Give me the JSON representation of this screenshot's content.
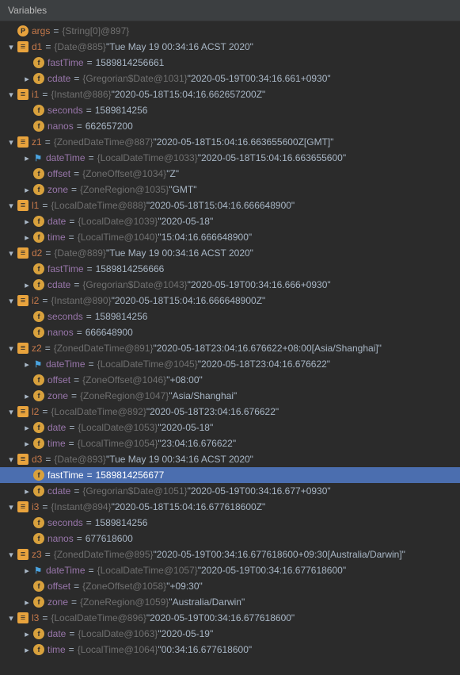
{
  "header": {
    "title": "Variables"
  },
  "rows": [
    {
      "indent": 0,
      "arrow": "none",
      "icon": "p",
      "iconText": "P",
      "name": "args",
      "nameClass": "",
      "type": "{String[0]@897}",
      "value": "",
      "selected": false
    },
    {
      "indent": 0,
      "arrow": "down",
      "icon": "obj",
      "iconText": "",
      "name": "d1",
      "nameClass": "",
      "type": "{Date@885}",
      "value": "\"Tue May 19 00:34:16 ACST 2020\"",
      "selected": false
    },
    {
      "indent": 1,
      "arrow": "none",
      "icon": "f",
      "iconText": "f",
      "name": "fastTime",
      "nameClass": "purple",
      "type": "",
      "value": "1589814256661",
      "selected": false
    },
    {
      "indent": 1,
      "arrow": "right",
      "icon": "f",
      "iconText": "f",
      "name": "cdate",
      "nameClass": "purple",
      "type": "{Gregorian$Date@1031}",
      "value": "\"2020-05-19T00:34:16.661+0930\"",
      "selected": false
    },
    {
      "indent": 0,
      "arrow": "down",
      "icon": "obj",
      "iconText": "",
      "name": "i1",
      "nameClass": "",
      "type": "{Instant@886}",
      "value": "\"2020-05-18T15:04:16.662657200Z\"",
      "selected": false
    },
    {
      "indent": 1,
      "arrow": "none",
      "icon": "f",
      "iconText": "f",
      "name": "seconds",
      "nameClass": "purple",
      "type": "",
      "value": "1589814256",
      "selected": false
    },
    {
      "indent": 1,
      "arrow": "none",
      "icon": "f",
      "iconText": "f",
      "name": "nanos",
      "nameClass": "purple",
      "type": "",
      "value": "662657200",
      "selected": false
    },
    {
      "indent": 0,
      "arrow": "down",
      "icon": "obj",
      "iconText": "",
      "name": "z1",
      "nameClass": "",
      "type": "{ZonedDateTime@887}",
      "value": "\"2020-05-18T15:04:16.663655600Z[GMT]\"",
      "selected": false
    },
    {
      "indent": 1,
      "arrow": "right",
      "icon": "flag",
      "iconText": "",
      "name": "dateTime",
      "nameClass": "purple",
      "type": "{LocalDateTime@1033}",
      "value": "\"2020-05-18T15:04:16.663655600\"",
      "selected": false
    },
    {
      "indent": 1,
      "arrow": "none",
      "icon": "f",
      "iconText": "f",
      "name": "offset",
      "nameClass": "purple",
      "type": "{ZoneOffset@1034}",
      "value": "\"Z\"",
      "selected": false
    },
    {
      "indent": 1,
      "arrow": "right",
      "icon": "f",
      "iconText": "f",
      "name": "zone",
      "nameClass": "purple",
      "type": "{ZoneRegion@1035}",
      "value": "\"GMT\"",
      "selected": false
    },
    {
      "indent": 0,
      "arrow": "down",
      "icon": "obj",
      "iconText": "",
      "name": "l1",
      "nameClass": "",
      "type": "{LocalDateTime@888}",
      "value": "\"2020-05-18T15:04:16.666648900\"",
      "selected": false
    },
    {
      "indent": 1,
      "arrow": "right",
      "icon": "f",
      "iconText": "f",
      "name": "date",
      "nameClass": "purple",
      "type": "{LocalDate@1039}",
      "value": "\"2020-05-18\"",
      "selected": false
    },
    {
      "indent": 1,
      "arrow": "right",
      "icon": "f",
      "iconText": "f",
      "name": "time",
      "nameClass": "purple",
      "type": "{LocalTime@1040}",
      "value": "\"15:04:16.666648900\"",
      "selected": false
    },
    {
      "indent": 0,
      "arrow": "down",
      "icon": "obj",
      "iconText": "",
      "name": "d2",
      "nameClass": "",
      "type": "{Date@889}",
      "value": "\"Tue May 19 00:34:16 ACST 2020\"",
      "selected": false
    },
    {
      "indent": 1,
      "arrow": "none",
      "icon": "f",
      "iconText": "f",
      "name": "fastTime",
      "nameClass": "purple",
      "type": "",
      "value": "1589814256666",
      "selected": false
    },
    {
      "indent": 1,
      "arrow": "right",
      "icon": "f",
      "iconText": "f",
      "name": "cdate",
      "nameClass": "purple",
      "type": "{Gregorian$Date@1043}",
      "value": "\"2020-05-19T00:34:16.666+0930\"",
      "selected": false
    },
    {
      "indent": 0,
      "arrow": "down",
      "icon": "obj",
      "iconText": "",
      "name": "i2",
      "nameClass": "",
      "type": "{Instant@890}",
      "value": "\"2020-05-18T15:04:16.666648900Z\"",
      "selected": false
    },
    {
      "indent": 1,
      "arrow": "none",
      "icon": "f",
      "iconText": "f",
      "name": "seconds",
      "nameClass": "purple",
      "type": "",
      "value": "1589814256",
      "selected": false
    },
    {
      "indent": 1,
      "arrow": "none",
      "icon": "f",
      "iconText": "f",
      "name": "nanos",
      "nameClass": "purple",
      "type": "",
      "value": "666648900",
      "selected": false
    },
    {
      "indent": 0,
      "arrow": "down",
      "icon": "obj",
      "iconText": "",
      "name": "z2",
      "nameClass": "",
      "type": "{ZonedDateTime@891}",
      "value": "\"2020-05-18T23:04:16.676622+08:00[Asia/Shanghai]\"",
      "selected": false
    },
    {
      "indent": 1,
      "arrow": "right",
      "icon": "flag",
      "iconText": "",
      "name": "dateTime",
      "nameClass": "purple",
      "type": "{LocalDateTime@1045}",
      "value": "\"2020-05-18T23:04:16.676622\"",
      "selected": false
    },
    {
      "indent": 1,
      "arrow": "none",
      "icon": "f",
      "iconText": "f",
      "name": "offset",
      "nameClass": "purple",
      "type": "{ZoneOffset@1046}",
      "value": "\"+08:00\"",
      "selected": false
    },
    {
      "indent": 1,
      "arrow": "right",
      "icon": "f",
      "iconText": "f",
      "name": "zone",
      "nameClass": "purple",
      "type": "{ZoneRegion@1047}",
      "value": "\"Asia/Shanghai\"",
      "selected": false
    },
    {
      "indent": 0,
      "arrow": "down",
      "icon": "obj",
      "iconText": "",
      "name": "l2",
      "nameClass": "",
      "type": "{LocalDateTime@892}",
      "value": "\"2020-05-18T23:04:16.676622\"",
      "selected": false
    },
    {
      "indent": 1,
      "arrow": "right",
      "icon": "f",
      "iconText": "f",
      "name": "date",
      "nameClass": "purple",
      "type": "{LocalDate@1053}",
      "value": "\"2020-05-18\"",
      "selected": false
    },
    {
      "indent": 1,
      "arrow": "right",
      "icon": "f",
      "iconText": "f",
      "name": "time",
      "nameClass": "purple",
      "type": "{LocalTime@1054}",
      "value": "\"23:04:16.676622\"",
      "selected": false
    },
    {
      "indent": 0,
      "arrow": "down",
      "icon": "obj",
      "iconText": "",
      "name": "d3",
      "nameClass": "",
      "type": "{Date@893}",
      "value": "\"Tue May 19 00:34:16 ACST 2020\"",
      "selected": false
    },
    {
      "indent": 1,
      "arrow": "none",
      "icon": "f",
      "iconText": "f",
      "name": "fastTime",
      "nameClass": "purple",
      "type": "",
      "value": "1589814256677",
      "selected": true
    },
    {
      "indent": 1,
      "arrow": "right",
      "icon": "f",
      "iconText": "f",
      "name": "cdate",
      "nameClass": "purple",
      "type": "{Gregorian$Date@1051}",
      "value": "\"2020-05-19T00:34:16.677+0930\"",
      "selected": false
    },
    {
      "indent": 0,
      "arrow": "down",
      "icon": "obj",
      "iconText": "",
      "name": "i3",
      "nameClass": "",
      "type": "{Instant@894}",
      "value": "\"2020-05-18T15:04:16.677618600Z\"",
      "selected": false
    },
    {
      "indent": 1,
      "arrow": "none",
      "icon": "f",
      "iconText": "f",
      "name": "seconds",
      "nameClass": "purple",
      "type": "",
      "value": "1589814256",
      "selected": false
    },
    {
      "indent": 1,
      "arrow": "none",
      "icon": "f",
      "iconText": "f",
      "name": "nanos",
      "nameClass": "purple",
      "type": "",
      "value": "677618600",
      "selected": false
    },
    {
      "indent": 0,
      "arrow": "down",
      "icon": "obj",
      "iconText": "",
      "name": "z3",
      "nameClass": "",
      "type": "{ZonedDateTime@895}",
      "value": "\"2020-05-19T00:34:16.677618600+09:30[Australia/Darwin]\"",
      "selected": false
    },
    {
      "indent": 1,
      "arrow": "right",
      "icon": "flag",
      "iconText": "",
      "name": "dateTime",
      "nameClass": "purple",
      "type": "{LocalDateTime@1057}",
      "value": "\"2020-05-19T00:34:16.677618600\"",
      "selected": false
    },
    {
      "indent": 1,
      "arrow": "none",
      "icon": "f",
      "iconText": "f",
      "name": "offset",
      "nameClass": "purple",
      "type": "{ZoneOffset@1058}",
      "value": "\"+09:30\"",
      "selected": false
    },
    {
      "indent": 1,
      "arrow": "right",
      "icon": "f",
      "iconText": "f",
      "name": "zone",
      "nameClass": "purple",
      "type": "{ZoneRegion@1059}",
      "value": "\"Australia/Darwin\"",
      "selected": false
    },
    {
      "indent": 0,
      "arrow": "down",
      "icon": "obj",
      "iconText": "",
      "name": "l3",
      "nameClass": "",
      "type": "{LocalDateTime@896}",
      "value": "\"2020-05-19T00:34:16.677618600\"",
      "selected": false
    },
    {
      "indent": 1,
      "arrow": "right",
      "icon": "f",
      "iconText": "f",
      "name": "date",
      "nameClass": "purple",
      "type": "{LocalDate@1063}",
      "value": "\"2020-05-19\"",
      "selected": false
    },
    {
      "indent": 1,
      "arrow": "right",
      "icon": "f",
      "iconText": "f",
      "name": "time",
      "nameClass": "purple",
      "type": "{LocalTime@1064}",
      "value": "\"00:34:16.677618600\"",
      "selected": false
    }
  ]
}
